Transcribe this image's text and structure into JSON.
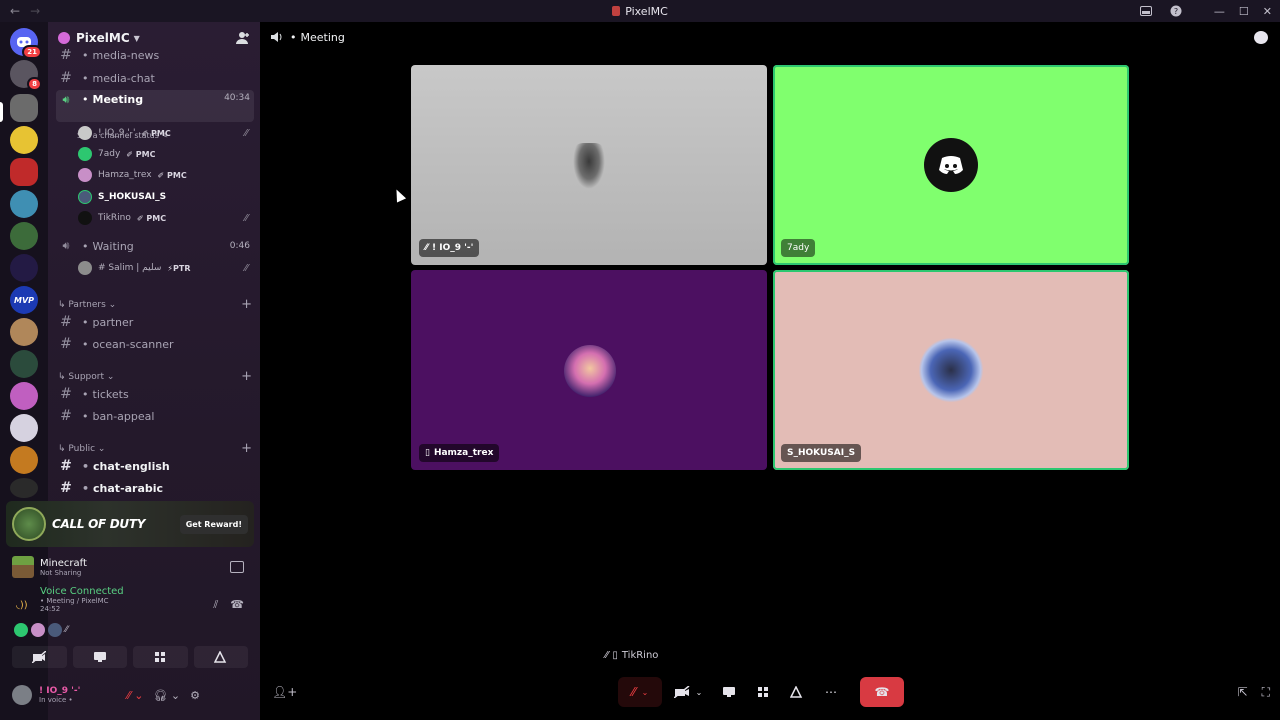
{
  "window": {
    "title": "PixelMC"
  },
  "guild": {
    "name": "PixelMC"
  },
  "rail": {
    "badges": {
      "home": "21",
      "second": "8"
    },
    "mvp_label": "MVP"
  },
  "channels": {
    "media_news": "media-news",
    "media_chat": "media-chat",
    "meeting": {
      "name": "Meeting",
      "timer": "40:34",
      "status": "Set a channel status"
    },
    "meeting_users": [
      {
        "name": "! IO_9 '-'",
        "tag": "PMC",
        "muted": true
      },
      {
        "name": "7ady",
        "tag": "PMC",
        "muted": false
      },
      {
        "name": "Hamza_trex",
        "tag": "PMC",
        "muted": false
      },
      {
        "name": "S_HOKUSAI_S",
        "tag": "",
        "muted": false
      },
      {
        "name": "TikRino",
        "tag": "PMC",
        "muted": true
      }
    ],
    "waiting": {
      "name": "Waiting",
      "timer": "0:46"
    },
    "waiting_users": [
      {
        "name": "# Salim | سليم",
        "tag": "PTR",
        "muted": true
      }
    ],
    "categories": {
      "partners": "Partners",
      "support": "Support",
      "public": "Public"
    },
    "partner": "partner",
    "ocean_scanner": "ocean-scanner",
    "tickets": "tickets",
    "ban_appeal": "ban-appeal",
    "chat_english": "chat-english",
    "chat_arabic": "chat-arabic"
  },
  "promo": {
    "title": "CALL OF DUTY",
    "button": "Get Reward!"
  },
  "activity": {
    "game": "Minecraft",
    "status": "Not Sharing"
  },
  "voice": {
    "title": "Voice Connected",
    "channel": "Meeting / PixelMC",
    "time": "24:52"
  },
  "user": {
    "name": "! IO_9 '-'",
    "status": "In voice •"
  },
  "main": {
    "channel_title": "Meeting",
    "tiles": [
      {
        "name": "! IO_9 '-'",
        "bg": "#bdbdbd"
      },
      {
        "name": "7ady",
        "bg": "#80ff6e"
      },
      {
        "name": "Hamza_trex",
        "bg": "#4c1061"
      },
      {
        "name": "S_HOKUSAI_S",
        "bg": "#e3bcb6"
      }
    ],
    "bottom_participant": "TikRino"
  }
}
